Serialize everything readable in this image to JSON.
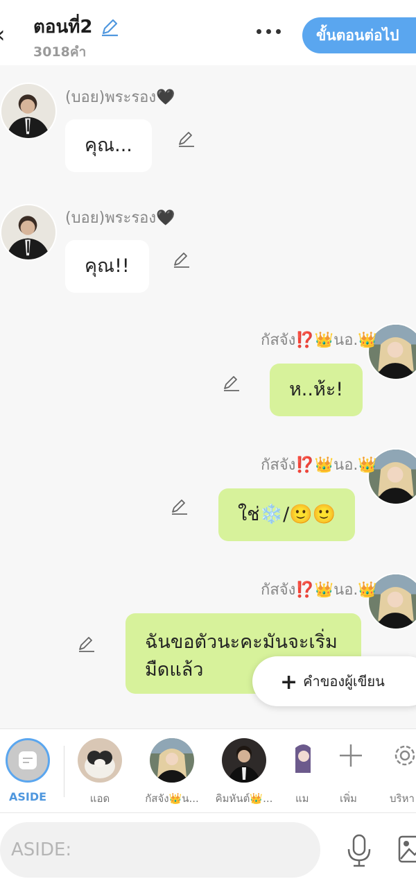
{
  "header": {
    "back_icon": "chevron-left-icon",
    "title": "ตอนที่2",
    "edit_icon": "pencil-icon",
    "word_count": "3018คำ",
    "more_icon": "more-horizontal-icon",
    "next_button": "ขั้นตอนต่อไป"
  },
  "messages": [
    {
      "side": "left",
      "name": "(บอย)พระรอง🖤",
      "text": "คุณ...",
      "avatar": "boy-avatar"
    },
    {
      "side": "left",
      "name": "(บอย)พระรอง🖤",
      "text": "คุณ!!",
      "avatar": "boy-avatar"
    },
    {
      "side": "right",
      "name": "กัสจัง⁉️👑นอ.👑",
      "text": "ห..ห้ะ!",
      "avatar": "girl-avatar"
    },
    {
      "side": "right",
      "name": "กัสจัง⁉️👑นอ.👑",
      "text": "ใช่❄️/🙂🙂",
      "avatar": "girl-avatar"
    },
    {
      "side": "right",
      "name": "กัสจัง⁉️👑นอ.👑",
      "text": "ฉันขอตัวนะคะมันจะเริ่มมืดแล้ว",
      "avatar": "girl-avatar"
    }
  ],
  "author_note_button": "คำของผู้เขียน",
  "characters": {
    "aside_label": "ASIDE",
    "items": [
      {
        "label": "แอด"
      },
      {
        "label": "กัสจัง👑น..."
      },
      {
        "label": "คิมหันต์👑..."
      },
      {
        "label": "แม"
      }
    ],
    "add_label": "เพิ่ม",
    "manage_label": "บริหา"
  },
  "input": {
    "placeholder": "ASIDE:",
    "mic_icon": "microphone-icon",
    "image_icon": "image-icon"
  },
  "colors": {
    "accent": "#5aa6ef",
    "green_bubble": "#d7f29b",
    "white_bubble": "#ffffff",
    "background": "#f7f7f7"
  }
}
